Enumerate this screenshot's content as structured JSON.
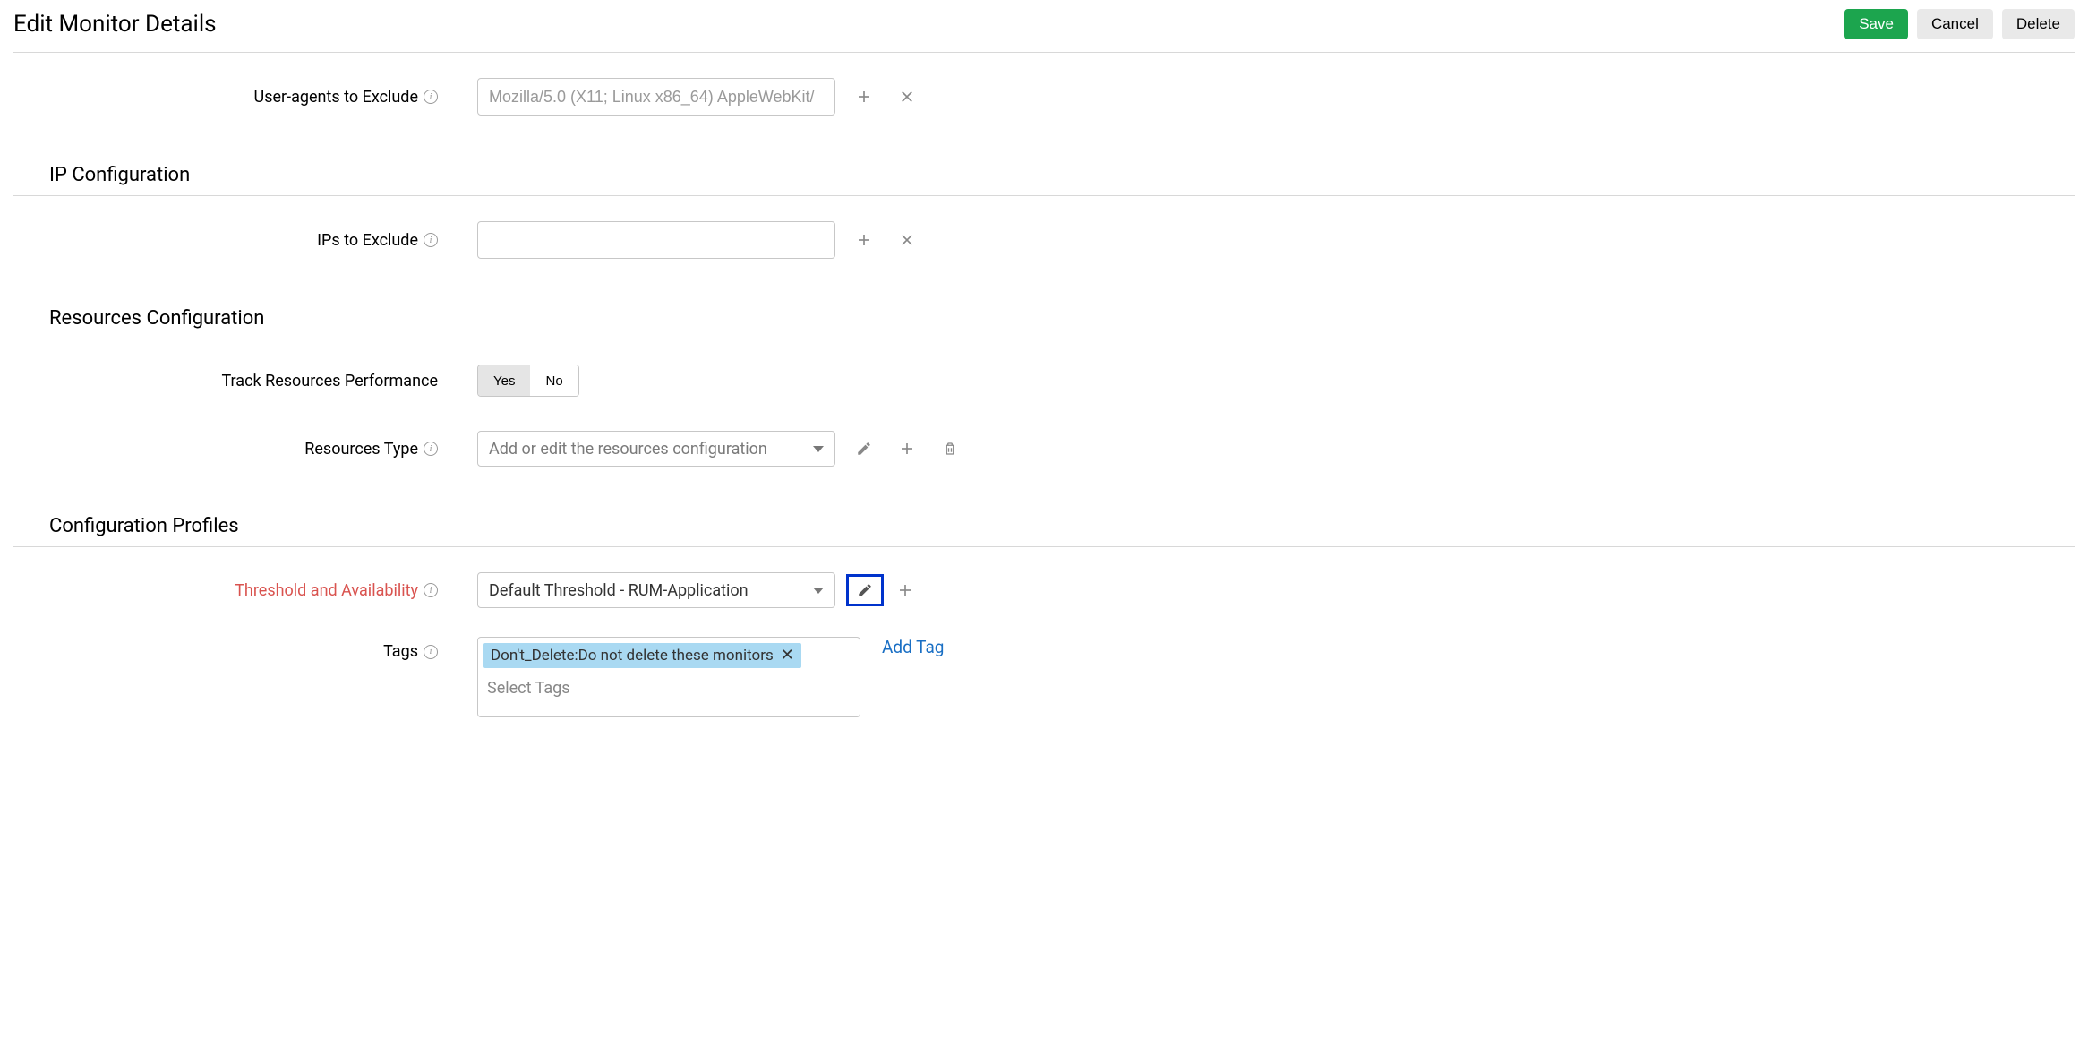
{
  "header": {
    "title": "Edit Monitor Details",
    "save_label": "Save",
    "cancel_label": "Cancel",
    "delete_label": "Delete"
  },
  "userAgents": {
    "label": "User-agents to Exclude",
    "placeholder": "Mozilla/5.0 (X11; Linux x86_64) AppleWebKit/"
  },
  "ipConfig": {
    "section_title": "IP Configuration",
    "label": "IPs to Exclude",
    "value": ""
  },
  "resourcesConfig": {
    "section_title": "Resources Configuration",
    "track_label": "Track Resources Performance",
    "yes_label": "Yes",
    "no_label": "No",
    "type_label": "Resources Type",
    "type_placeholder": "Add or edit the resources configuration"
  },
  "configProfiles": {
    "section_title": "Configuration Profiles",
    "threshold_label": "Threshold and Availability",
    "threshold_value": "Default Threshold - RUM-Application",
    "tags_label": "Tags",
    "tag_chip": "Don't_Delete:Do not delete these monitors",
    "tags_placeholder": "Select Tags",
    "add_tag_label": "Add Tag"
  }
}
